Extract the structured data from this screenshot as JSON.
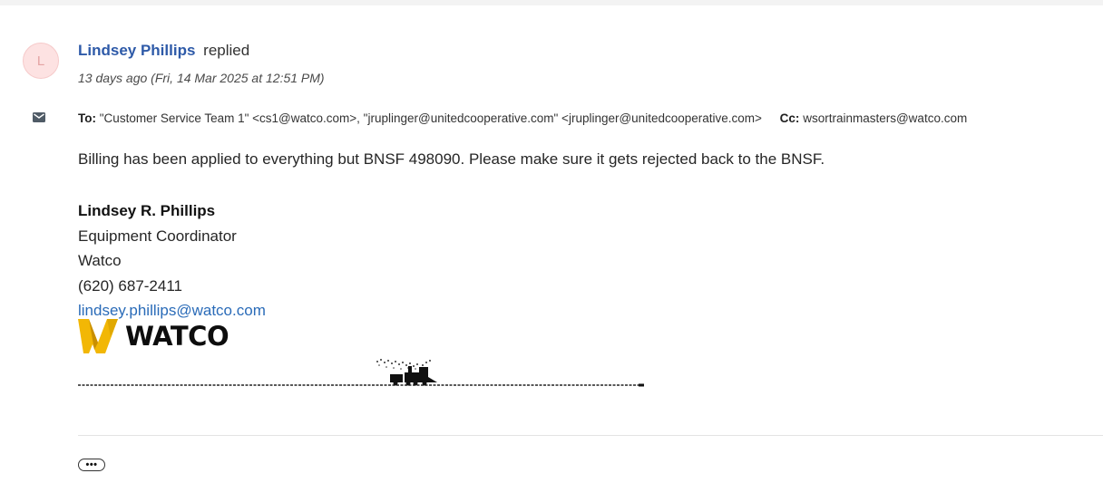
{
  "message": {
    "avatar_initial": "L",
    "sender_name": "Lindsey Phillips",
    "action": "replied",
    "timestamp": "13 days ago (Fri, 14 Mar 2025 at 12:51 PM)",
    "to_label": "To:",
    "to_value": "\"Customer Service Team 1\" <cs1@watco.com>, \"jruplinger@unitedcooperative.com\" <jruplinger@unitedcooperative.com>",
    "cc_label": "Cc:",
    "cc_value": "wsortrainmasters@watco.com",
    "body": "Billing has been applied to everything but BNSF 498090. Please make sure it gets rejected back to the BNSF."
  },
  "signature": {
    "name": "Lindsey R. Phillips",
    "title": "Equipment Coordinator",
    "company": "Watco",
    "phone": "(620) 687-2411",
    "email": "lindsey.phillips@watco.com",
    "logo_text": "WATCO",
    "logo_colors": {
      "mark": "#f2b705",
      "text": "#0d0d0d"
    }
  },
  "actions": {
    "more_label": "•••"
  },
  "colors": {
    "link": "#2e5aa8",
    "avatar_bg": "#fde2e2",
    "avatar_fg": "#e4a3a3"
  },
  "icons": {
    "recipients": "mail-icon",
    "more": "more-dots-icon"
  }
}
